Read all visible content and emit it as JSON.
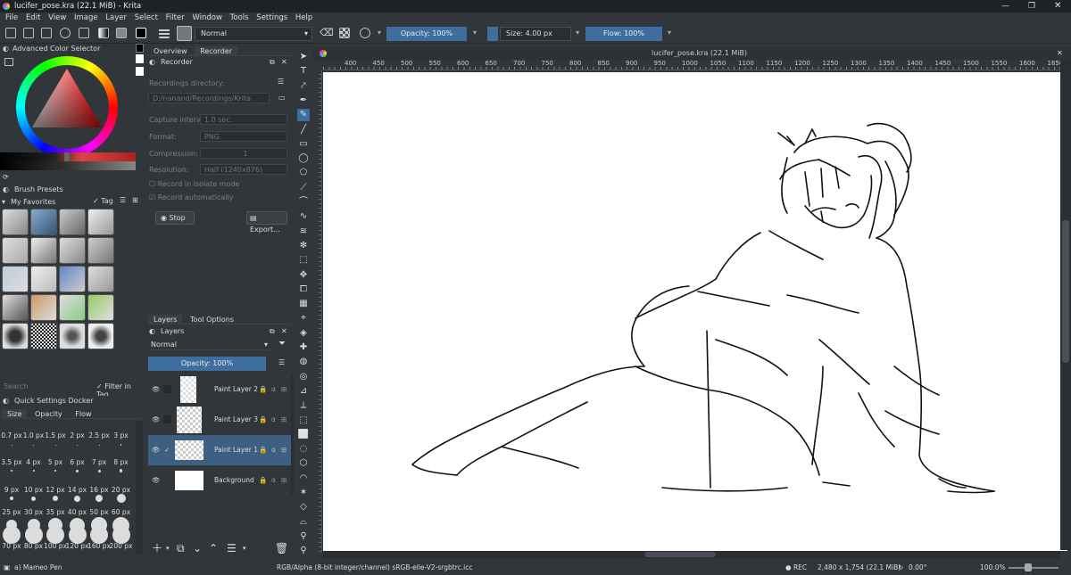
{
  "window": {
    "title": "lucifer_pose.kra (22.1 MiB) - Krita",
    "doc_title": "lucifer_pose.kra (22.1 MiB)"
  },
  "menu": [
    "File",
    "Edit",
    "View",
    "Image",
    "Layer",
    "Select",
    "Filter",
    "Window",
    "Tools",
    "Settings",
    "Help"
  ],
  "toolbar": {
    "blend_mode": "Normal",
    "opacity_label": "Opacity: 100%",
    "size_label": "Size: 4.00 px",
    "flow_label": "Flow: 100%"
  },
  "color_selector": {
    "title": "Advanced Color Selector"
  },
  "brush_presets": {
    "title": "Brush Presets",
    "tag": "My Favorites",
    "tag_button": "Tag",
    "search_placeholder": "Search",
    "filter_label": "Filter in Tag"
  },
  "quick_settings": {
    "title": "Quick Settings Docker",
    "tabs": [
      "Size",
      "Opacity",
      "Flow"
    ],
    "sizes": [
      "0.7 px",
      "1.0 px",
      "1.5 px",
      "2 px",
      "2.5 px",
      "3 px",
      "3.5 px",
      "4 px",
      "5 px",
      "6 px",
      "7 px",
      "8 px",
      "9 px",
      "10 px",
      "12 px",
      "14 px",
      "16 px",
      "20 px",
      "25 px",
      "30 px",
      "35 px",
      "40 px",
      "50 px",
      "60 px",
      "70 px",
      "80 px",
      "100 px",
      "120 px",
      "160 px",
      "200 px"
    ]
  },
  "recorder": {
    "tabs": [
      "Overview",
      "Recorder"
    ],
    "title": "Recorder",
    "dir_label": "Recordings directory:",
    "dir_value": "D:/nanand/Recordings/Krita",
    "capture_label": "Capture interval:",
    "capture_value": "1.0 sec.",
    "format_label": "Format:",
    "format_value": "PNG",
    "compression_label": "Compression:",
    "compression_value": "1",
    "resolution_label": "Resolution:",
    "resolution_value": "Half (1240x876)",
    "isolate_label": "Record in isolate mode",
    "auto_label": "Record automatically",
    "stop_label": "Stop",
    "export_label": "Export..."
  },
  "layers": {
    "tabs": [
      "Layers",
      "Tool Options"
    ],
    "title": "Layers",
    "blend_mode": "Normal",
    "opacity_label": "Opacity: 100%",
    "items": [
      {
        "name": "Paint Layer 2",
        "selected": false
      },
      {
        "name": "Paint Layer 3",
        "selected": false
      },
      {
        "name": "Paint Layer 1",
        "selected": true
      },
      {
        "name": "Background",
        "selected": false
      }
    ]
  },
  "ruler": {
    "labels": [
      "400",
      "450",
      "500",
      "550",
      "600",
      "650",
      "700",
      "750",
      "800",
      "850",
      "900",
      "950",
      "1000",
      "1050",
      "1100",
      "1150",
      "1200",
      "1250",
      "1300",
      "1350",
      "1400",
      "1450",
      "1500",
      "1550",
      "1600",
      "1650"
    ]
  },
  "status": {
    "brush_name": "a) Mameo Pen",
    "color_info": "RGB/Alpha (8-bit integer/channel)  sRGB-elle-V2-srgbtrc.icc",
    "rec": "REC",
    "dimensions": "2,480 x 1,754 (22.1 MiB)",
    "rotation": "0.00°",
    "zoom": "100.0%"
  },
  "colors": {
    "accent": "#3d6e9e",
    "panel": "#31363b",
    "canvas": "#ffffff"
  }
}
